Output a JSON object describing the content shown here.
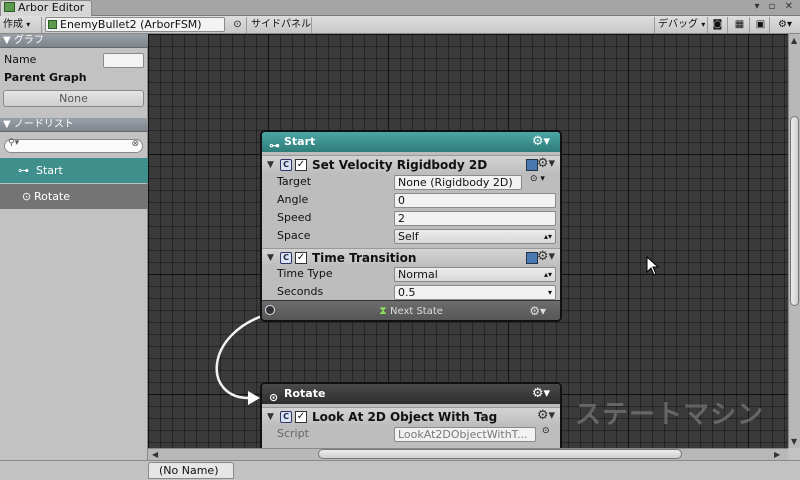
{
  "window": {
    "title": "Arbor Editor",
    "tab_icons": "▾ ▫ ✕"
  },
  "toolbar": {
    "create_label": "作成",
    "fsm_value": "EnemyBullet2 (ArborFSM)",
    "side_panel_label": "サイドパネル",
    "debug_label": "デバッグ"
  },
  "sidebar": {
    "graph_section": "グラフ",
    "name_label": "Name",
    "name_value": "",
    "parent_graph_label": "Parent Graph",
    "parent_graph_value": "None",
    "node_list_section": "ノードリスト",
    "search_value": "",
    "nodes": [
      {
        "label": "Start",
        "selected": true,
        "icon": "start-state-icon"
      },
      {
        "label": "Rotate",
        "selected": false,
        "icon": "state-icon"
      }
    ]
  },
  "canvas": {
    "watermark": "ステートマシン",
    "start_node": {
      "title": "Start",
      "header_color": "#3b8f8f",
      "behaviours": [
        {
          "title": "Set Velocity Rigidbody 2D",
          "props": [
            {
              "label": "Target",
              "value": "None (Rigidbody 2D)"
            },
            {
              "label": "Angle",
              "value": "0"
            },
            {
              "label": "Speed",
              "value": "2"
            },
            {
              "label": "Space",
              "value": "Self"
            }
          ]
        },
        {
          "title": "Time Transition",
          "props": [
            {
              "label": "Time Type",
              "value": "Normal"
            },
            {
              "label": "Seconds",
              "value": "0.5"
            }
          ]
        }
      ],
      "link_label": "Next State"
    },
    "rotate_node": {
      "title": "Rotate",
      "header_color": "#3a3a3a",
      "behaviours": [
        {
          "title": "Look At 2D Object With Tag",
          "props": [
            {
              "label": "Script",
              "value": "LookAt2DObjectWithT..."
            }
          ]
        }
      ]
    }
  },
  "statusbar": {
    "tab_label": "(No Name)"
  }
}
